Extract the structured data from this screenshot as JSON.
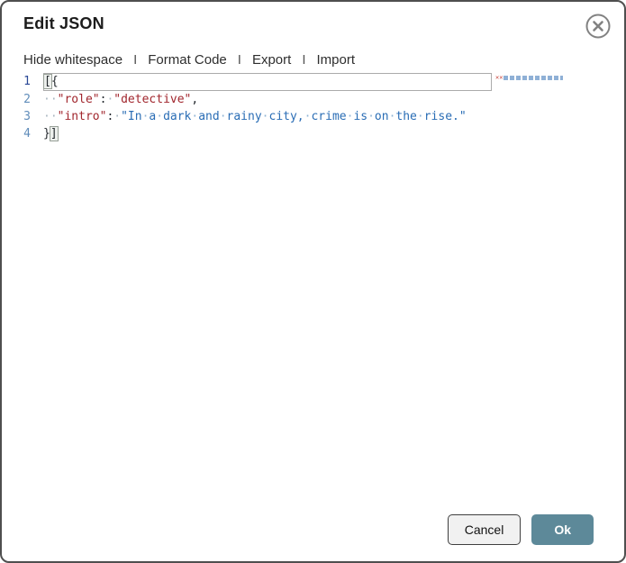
{
  "dialog": {
    "title": "Edit JSON"
  },
  "toolbar": {
    "separator": "I",
    "items": [
      {
        "label": "Hide whitespace"
      },
      {
        "label": "Format Code"
      },
      {
        "label": "Export"
      },
      {
        "label": "Import"
      }
    ]
  },
  "editor": {
    "json_text": "[{\n  \"role\": \"detective\",\n  \"intro\": \"In a dark and rainy city, crime is on the rise.\"\n}]",
    "lines": [
      {
        "number": "1",
        "segments": [
          {
            "t": "[",
            "c": "bracket-match"
          },
          {
            "t": "{",
            "c": "bracket"
          }
        ]
      },
      {
        "number": "2",
        "segments": [
          {
            "t": "··",
            "c": "ws"
          },
          {
            "t": "\"role\"",
            "c": "key"
          },
          {
            "t": ":",
            "c": "punct"
          },
          {
            "t": "·",
            "c": "ws"
          },
          {
            "t": "\"detective\"",
            "c": "str-red"
          },
          {
            "t": ",",
            "c": "punct"
          }
        ]
      },
      {
        "number": "3",
        "segments": [
          {
            "t": "··",
            "c": "ws"
          },
          {
            "t": "\"intro\"",
            "c": "key"
          },
          {
            "t": ":",
            "c": "punct"
          },
          {
            "t": "·",
            "c": "ws"
          },
          {
            "t": "\"In",
            "c": "str-blue"
          },
          {
            "t": "·",
            "c": "ws-blue"
          },
          {
            "t": "a",
            "c": "str-blue"
          },
          {
            "t": "·",
            "c": "ws-blue"
          },
          {
            "t": "dark",
            "c": "str-blue"
          },
          {
            "t": "·",
            "c": "ws-blue"
          },
          {
            "t": "and",
            "c": "str-blue"
          },
          {
            "t": "·",
            "c": "ws-blue"
          },
          {
            "t": "rainy",
            "c": "str-blue"
          },
          {
            "t": "·",
            "c": "ws-blue"
          },
          {
            "t": "city,",
            "c": "str-blue"
          },
          {
            "t": "·",
            "c": "ws-blue"
          },
          {
            "t": "crime",
            "c": "str-blue"
          },
          {
            "t": "·",
            "c": "ws-blue"
          },
          {
            "t": "is",
            "c": "str-blue"
          },
          {
            "t": "·",
            "c": "ws-blue"
          },
          {
            "t": "on",
            "c": "str-blue"
          },
          {
            "t": "·",
            "c": "ws-blue"
          },
          {
            "t": "the",
            "c": "str-blue"
          },
          {
            "t": "·",
            "c": "ws-blue"
          },
          {
            "t": "rise.\"",
            "c": "str-blue"
          }
        ]
      },
      {
        "number": "4",
        "segments": [
          {
            "t": "}",
            "c": "punct"
          },
          {
            "t": "]",
            "c": "bracket-match"
          }
        ]
      }
    ]
  },
  "footer": {
    "cancel_label": "Cancel",
    "ok_label": "Ok"
  },
  "colors": {
    "key_red": "#a1262d",
    "string_blue": "#2a6db5",
    "whitespace_dot": "#a9b6c0",
    "line_number": "#5f8cba",
    "ok_button_bg": "#5d8999",
    "border_gray": "#4f4f4f"
  }
}
